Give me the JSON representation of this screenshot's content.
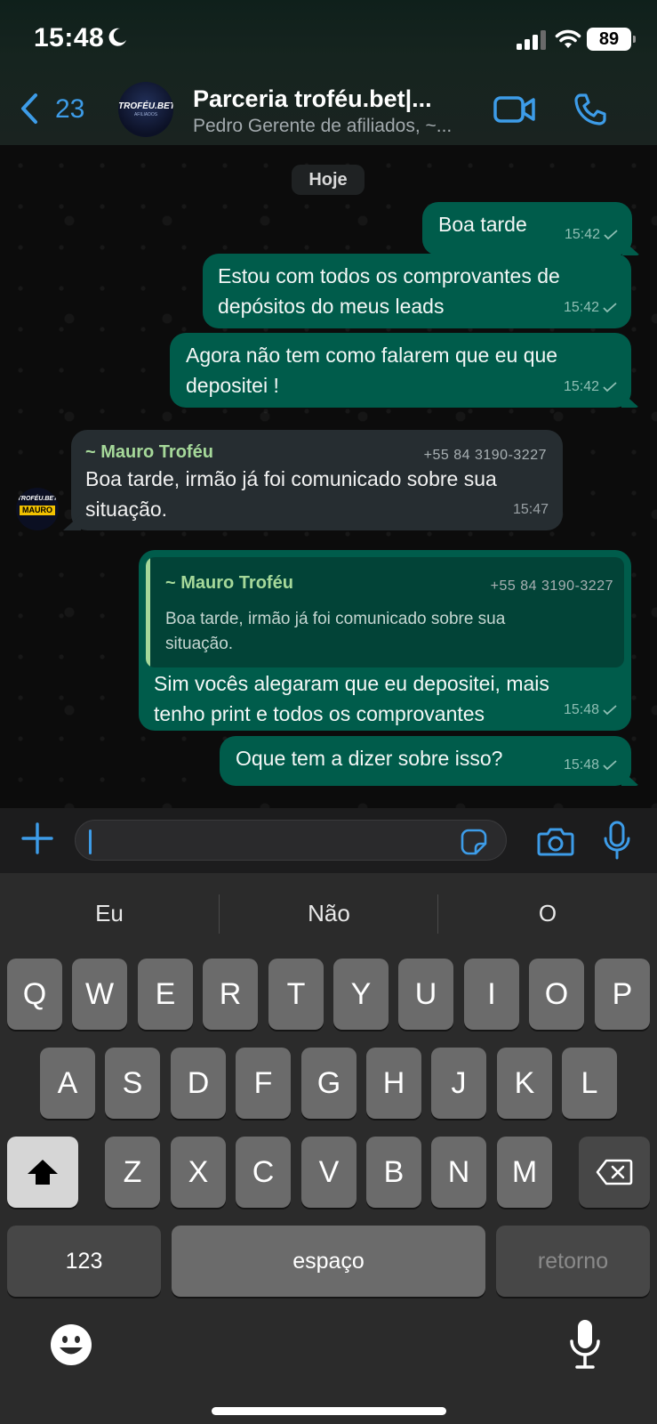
{
  "status_bar": {
    "time": "15:48",
    "battery": "89"
  },
  "header": {
    "back_count": "23",
    "title": "Parceria troféu.bet|...",
    "subtitle": "Pedro Gerente de afiliados, ~...",
    "avatar_text": "TROFÉU.BET",
    "avatar_subtext": "AFILIADOS"
  },
  "chat": {
    "date_label": "Hoje",
    "messages": [
      {
        "direction": "out",
        "text_lines": [
          "Boa tarde"
        ],
        "time": "15:42"
      },
      {
        "direction": "out",
        "text_lines": [
          "Estou com todos os comprovantes de",
          "depósitos do meus leads"
        ],
        "time": "15:42"
      },
      {
        "direction": "out",
        "text_lines": [
          "Agora não tem como falarem que eu que",
          "depositei !"
        ],
        "time": "15:42"
      },
      {
        "direction": "in",
        "sender": "~ Mauro Troféu",
        "sender_phone": "+55 84 3190-3227",
        "text_lines": [
          "Boa tarde, irmão já foi comunicado sobre sua",
          "situação."
        ],
        "time": "15:47",
        "avatar_top": "TROFÉU.BET",
        "avatar_label": "MAURO"
      },
      {
        "direction": "out",
        "quote": {
          "sender": "~ Mauro Troféu",
          "sender_phone": "+55 84 3190-3227",
          "text_lines": [
            "Boa tarde, irmão já foi comunicado sobre sua",
            "situação."
          ]
        },
        "text_lines": [
          "Sim vocês alegaram que eu depositei, mais",
          "tenho print e todos os comprovantes"
        ],
        "time": "15:48"
      },
      {
        "direction": "out",
        "text_lines": [
          "Oque tem a dizer sobre isso?"
        ],
        "time": "15:48"
      }
    ]
  },
  "input_bar": {
    "value": ""
  },
  "keyboard": {
    "suggestions": [
      "Eu",
      "Não",
      "O"
    ],
    "row1": [
      "Q",
      "W",
      "E",
      "R",
      "T",
      "Y",
      "U",
      "I",
      "O",
      "P"
    ],
    "row2": [
      "A",
      "S",
      "D",
      "F",
      "G",
      "H",
      "J",
      "K",
      "L"
    ],
    "row3": [
      "Z",
      "X",
      "C",
      "V",
      "B",
      "N",
      "M"
    ],
    "numbers_key": "123",
    "space_key": "espaço",
    "return_key": "retorno"
  },
  "colors": {
    "accent": "#3d9ce8",
    "outgoing_bubble": "#005c4b",
    "incoming_bubble": "#262d31",
    "sender_name": "#a6d99a"
  },
  "icons": {
    "moon": "moon-icon",
    "signal": "signal-icon",
    "wifi": "wifi-icon",
    "back": "chevron-left-icon",
    "video": "video-call-icon",
    "phone": "phone-call-icon",
    "plus": "plus-icon",
    "sticker": "sticker-icon",
    "camera": "camera-icon",
    "mic": "microphone-icon",
    "shift": "shift-icon",
    "backspace": "backspace-icon",
    "emoji": "emoji-icon",
    "dictation": "dictation-icon",
    "read": "check-icon"
  }
}
